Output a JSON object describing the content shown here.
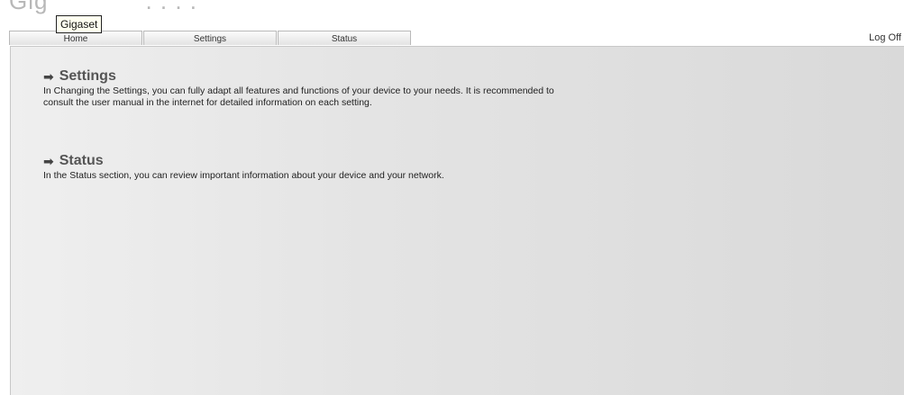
{
  "tooltip": "Gigaset",
  "tabs": [
    {
      "label": "Home"
    },
    {
      "label": "Settings"
    },
    {
      "label": "Status"
    }
  ],
  "header": {
    "logoff_label": "Log Off"
  },
  "sections": [
    {
      "title": "Settings",
      "icon": "arrow-right-icon",
      "text": "In Changing the Settings, you can fully adapt all features and functions of your device to your needs. It is recommended to consult the user manual in the internet for detailed information on each setting."
    },
    {
      "title": "Status",
      "icon": "arrow-right-icon",
      "text": "In the Status section, you can review important information about your device and your network."
    }
  ]
}
